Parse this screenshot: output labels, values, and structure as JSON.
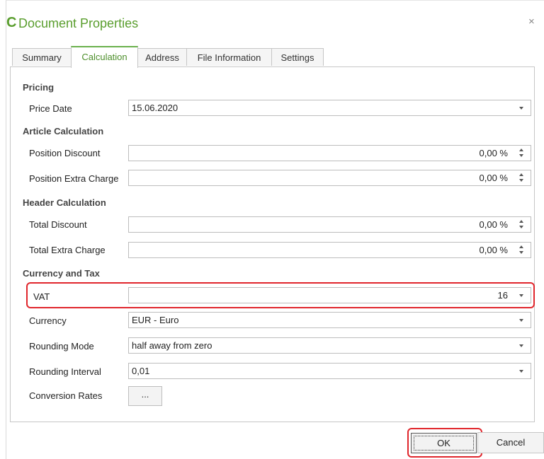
{
  "dialog": {
    "logo": "C",
    "title": "Document Properties",
    "close": "×"
  },
  "tabs": [
    {
      "label": "Summary",
      "active": false
    },
    {
      "label": "Calculation",
      "active": true
    },
    {
      "label": "Address",
      "active": false
    },
    {
      "label": "File Information",
      "active": false
    },
    {
      "label": "Settings",
      "active": false
    }
  ],
  "sections": {
    "pricing": "Pricing",
    "article": "Article Calculation",
    "header": "Header Calculation",
    "currency_tax": "Currency and Tax"
  },
  "fields": {
    "price_date": {
      "label": "Price Date",
      "value": "15.06.2020"
    },
    "position_discount": {
      "label": "Position Discount",
      "value": "0,00 %"
    },
    "position_extra": {
      "label": "Position Extra Charge",
      "value": "0,00 %"
    },
    "total_discount": {
      "label": "Total Discount",
      "value": "0,00 %"
    },
    "total_extra": {
      "label": "Total Extra Charge",
      "value": "0,00 %"
    },
    "vat": {
      "label": "VAT",
      "value": "16"
    },
    "currency": {
      "label": "Currency",
      "value": "EUR - Euro"
    },
    "rounding_mode": {
      "label": "Rounding Mode",
      "value": "half away from zero"
    },
    "rounding_interval": {
      "label": "Rounding Interval",
      "value": "0,01"
    },
    "conversion_rates": {
      "label": "Conversion Rates",
      "button": "..."
    }
  },
  "buttons": {
    "ok": "OK",
    "cancel": "Cancel"
  },
  "colors": {
    "accent": "#5a9e2e",
    "highlight": "#e0262c"
  }
}
